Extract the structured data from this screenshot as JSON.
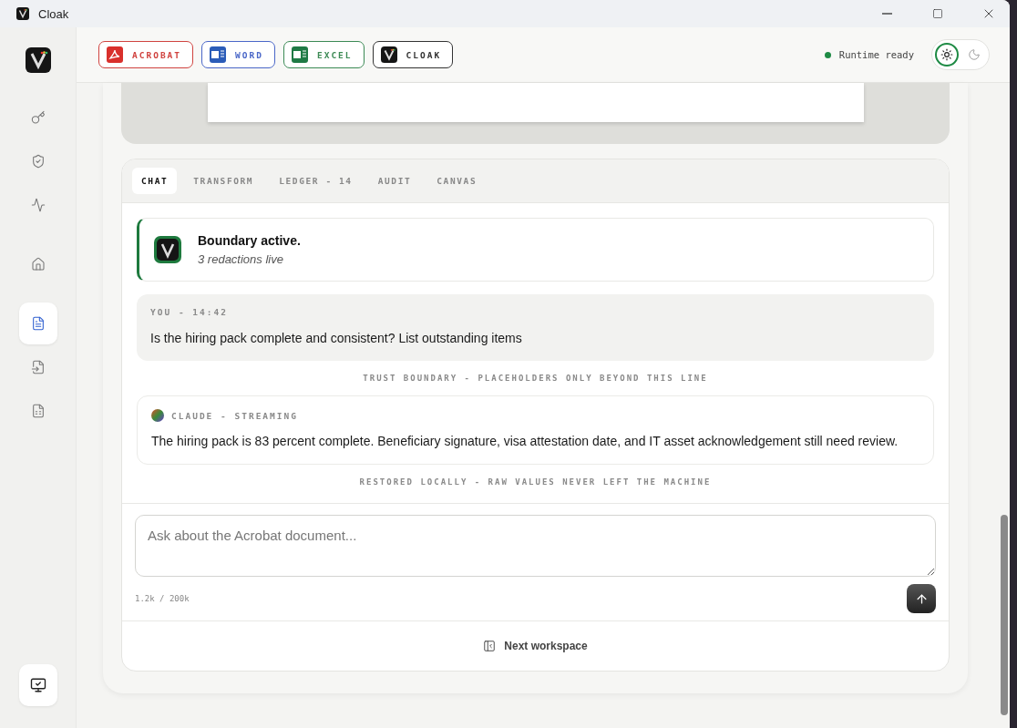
{
  "window": {
    "title": "Cloak"
  },
  "sidebar": {
    "items": [
      {
        "kind": "key",
        "selected": false
      },
      {
        "kind": "shield",
        "selected": false
      },
      {
        "kind": "activity",
        "selected": false
      },
      {
        "kind": "home",
        "selected": false
      },
      {
        "kind": "document",
        "selected": true
      },
      {
        "kind": "import",
        "selected": false
      },
      {
        "kind": "sheet",
        "selected": false
      }
    ]
  },
  "apps": [
    {
      "kind": "acrobat",
      "label": "ACROBAT",
      "color": "#d0433f"
    },
    {
      "kind": "word",
      "label": "WORD",
      "color": "#4a67c8"
    },
    {
      "kind": "excel",
      "label": "EXCEL",
      "color": "#3c8a55"
    },
    {
      "kind": "cloak",
      "label": "CLOAK",
      "color": "#333333"
    }
  ],
  "status": {
    "label": "Runtime ready",
    "color": "#1e8a44"
  },
  "theme_toggle": [
    {
      "kind": "light",
      "selected": true
    },
    {
      "kind": "dark",
      "selected": false
    }
  ],
  "tabs": [
    {
      "label": "CHAT",
      "selected": true
    },
    {
      "label": "TRANSFORM",
      "selected": false
    },
    {
      "label": "LEDGER - 14",
      "selected": false
    },
    {
      "label": "AUDIT",
      "selected": false
    },
    {
      "label": "CANVAS",
      "selected": false
    }
  ],
  "banner": {
    "title": "Boundary active.",
    "subtitle": "3 redactions live"
  },
  "messages": [
    {
      "kind": "user",
      "meta": "YOU - 14:42",
      "text": "Is the hiring pack complete and consistent? List outstanding items"
    },
    {
      "kind": "divider",
      "text": "TRUST BOUNDARY - PLACEHOLDERS ONLY BEYOND THIS LINE"
    },
    {
      "kind": "assistant",
      "meta": "CLAUDE - STREAMING",
      "text": "The hiring pack is 83 percent complete. Beneficiary signature, visa attestation date, and IT asset acknowledgement still need review."
    },
    {
      "kind": "divider",
      "text": "RESTORED LOCALLY - RAW VALUES NEVER LEFT THE MACHINE"
    }
  ],
  "composer": {
    "placeholder": "Ask about the Acrobat document...",
    "counter": "1.2k / 200k"
  },
  "footer": {
    "label": "Next workspace"
  }
}
